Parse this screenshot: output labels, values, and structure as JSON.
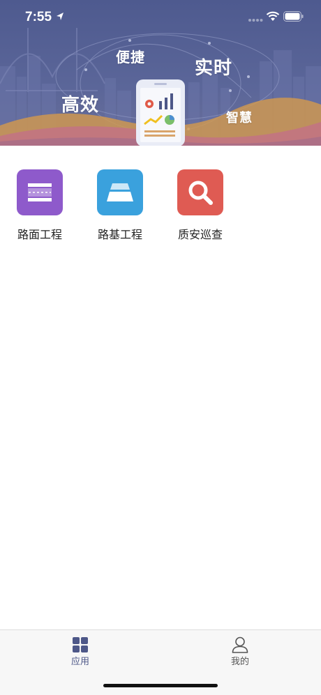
{
  "status_bar": {
    "time": "7:55",
    "location_icon": "location-arrow-icon",
    "signal_icon": "cellular-signal-icon",
    "wifi_icon": "wifi-icon",
    "battery_icon": "battery-icon"
  },
  "banner": {
    "words": [
      "便捷",
      "实时",
      "高效",
      "智慧"
    ],
    "illustration": "phone-dashboard-illustration",
    "colors": {
      "background": "#56609a",
      "wave_orange": "#d59a4c",
      "wave_pink": "#c36f8a"
    }
  },
  "apps": [
    {
      "label": "路面工程",
      "icon": "road-surface-icon",
      "color": "#8e5acb"
    },
    {
      "label": "路基工程",
      "icon": "roadbed-icon",
      "color": "#3aa1dd"
    },
    {
      "label": "质安巡查",
      "icon": "search-magnifier-icon",
      "color": "#df5b53"
    }
  ],
  "tab_bar": {
    "tabs": [
      {
        "label": "应用",
        "icon": "grid-apps-icon",
        "active": true
      },
      {
        "label": "我的",
        "icon": "user-profile-icon",
        "active": false
      }
    ],
    "active_color": "#4d5788"
  }
}
